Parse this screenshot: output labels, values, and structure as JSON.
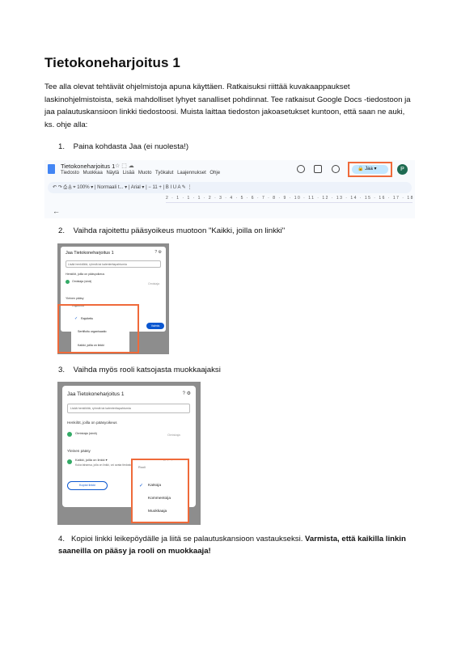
{
  "document": {
    "title": "Tietokoneharjoitus 1",
    "intro": "Tee alla olevat tehtävät ohjelmistoja apuna käyttäen. Ratkaisuksi riittää kuvakaappaukset laskinohjelmistoista, sekä mahdolliset lyhyet sanalliset pohdinnat. Tee ratkaisut Google Docs -tiedostoon ja jaa palautuskansioon linkki tiedostoosi. Muista laittaa tiedoston jakoasetukset kuntoon, että saan ne auki, ks. ohje alla:",
    "steps": [
      {
        "num": "1.",
        "text": "Paina kohdasta Jaa (ei nuolesta!)"
      },
      {
        "num": "2.",
        "text": "Vaihda rajoitettu pääsyoikeus muotoon \"Kaikki, joilla on linkki\""
      },
      {
        "num": "3.",
        "text": "Vaihda myös rooli katsojasta muokkaajaksi"
      },
      {
        "num": "4.",
        "text": "Kopioi linkki leikepöydälle ja liitä se palautuskansioon vastaukseksi. ",
        "bold": "Varmista, että kaikilla linkin saaneilla on pääsy ja rooli on muokkaaja!"
      }
    ]
  },
  "shot1": {
    "doc_title": "Tietokoneharjoitus 1",
    "menu": "Tiedosto Muokkaa Näytä Lisää Muoto Työkalut Laajennukset Ohje",
    "share_label": "Jaa",
    "avatar": "P",
    "toolbar": "↶ ↷ ⎙ A̲ ⌖ 100% ▾ | Normaali t... ▾ | Arial ▾ | − 11 + | B I U A ✎ ⋮",
    "ruler": "2 · 1 · 1 · 1 · 2 · 3 · 4 · 5 · 6 · 7 · 8 · 9 · 10 · 11 · 12 · 13 · 14 · 15 · 16 · 17 · 18",
    "back": "←"
  },
  "shot2": {
    "title": "Jaa Tietokoneharjoitus 1",
    "input_placeholder": "Lisää henkilöitä, ryhmiä tai kalenteritapahtumia",
    "people_heading": "Henkilöt, joilla on pääsyoikeus",
    "owner_name": "Omistaja (sinä)",
    "owner_note": "Omistaja",
    "general_heading": "Yleinen pääsy",
    "restricted": "Rajoitettu",
    "menu_items": [
      "Rajoitettu",
      "Sertifioitu organisaatio",
      "Kaikki, joilla on linkki"
    ],
    "done": "Valmis"
  },
  "shot3": {
    "title": "Jaa Tietokoneharjoitus 1",
    "input_placeholder": "Lisää henkilöitä, ryhmiä tai kalenteritapahtumia",
    "people_heading": "Henkilöt, joilla on pääsyoikeus",
    "owner_name": "Omistaja (sinä)",
    "owner_note": "Omistaja",
    "general_heading": "Yleinen pääsy",
    "anyone": "Kaikki, joilla on linkki ▾",
    "anyone_note": "Kuka tahansa, jolla on linkki, voi avata tiedoston",
    "role_current": "Katsoja ▾",
    "copy_link": "Kopioi linkki",
    "menu_heading": "Rooli",
    "menu_items": [
      "Katsoja",
      "Kommentoija",
      "Muokkaaja"
    ]
  }
}
